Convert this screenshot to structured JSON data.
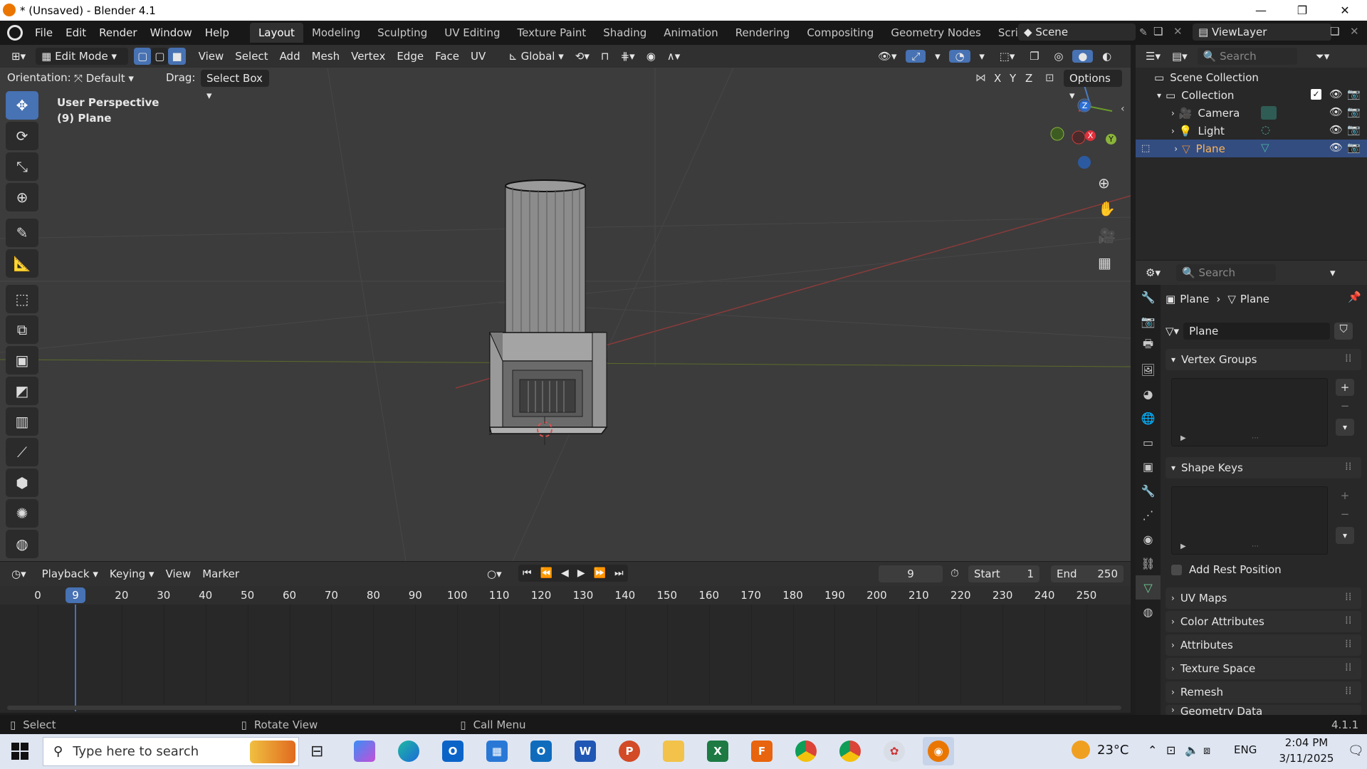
{
  "window": {
    "title": "* (Unsaved) - Blender 4.1",
    "minimize": "—",
    "maximize": "❐",
    "close": "✕"
  },
  "menu": [
    "File",
    "Edit",
    "Render",
    "Window",
    "Help"
  ],
  "workspaces": [
    "Layout",
    "Modeling",
    "Sculpting",
    "UV Editing",
    "Texture Paint",
    "Shading",
    "Animation",
    "Rendering",
    "Compositing",
    "Geometry Nodes",
    "Scripting"
  ],
  "active_workspace": "Layout",
  "scene": {
    "name": "Scene",
    "view_layer": "ViewLayer"
  },
  "viewport_header": {
    "mode": "Edit Mode",
    "menus": [
      "View",
      "Select",
      "Add",
      "Mesh",
      "Vertex",
      "Edge",
      "Face",
      "UV"
    ],
    "transform_orientation": "Global",
    "orientation_label": "Orientation:",
    "orientation_value": "Default",
    "drag_label": "Drag:",
    "drag_value": "Select Box",
    "axes": [
      "X",
      "Y",
      "Z"
    ],
    "options": "Options"
  },
  "viewport": {
    "perspective": "User Perspective",
    "object": "(9) Plane"
  },
  "gizmo": {
    "z": "Z",
    "x": "X",
    "y": "Y"
  },
  "outliner": {
    "search_placeholder": "Search",
    "scene_collection": "Scene Collection",
    "collection": "Collection",
    "items": [
      {
        "name": "Camera",
        "icon": "camera-icon"
      },
      {
        "name": "Light",
        "icon": "light-icon"
      },
      {
        "name": "Plane",
        "icon": "mesh-icon",
        "selected": true
      }
    ]
  },
  "properties": {
    "search_placeholder": "Search",
    "breadcrumb_object": "Plane",
    "breadcrumb_data": "Plane",
    "mesh_name": "Plane",
    "panels_open": [
      "Vertex Groups",
      "Shape Keys"
    ],
    "add_rest_position": "Add Rest Position",
    "panels_closed": [
      "UV Maps",
      "Color Attributes",
      "Attributes",
      "Texture Space",
      "Remesh",
      "Geometry Data"
    ]
  },
  "timeline": {
    "menus": [
      "Playback",
      "Keying",
      "View",
      "Marker"
    ],
    "current_frame": "9",
    "start_label": "Start",
    "start": "1",
    "end_label": "End",
    "end": "250",
    "ruler": [
      "0",
      "9",
      "20",
      "30",
      "40",
      "50",
      "60",
      "70",
      "80",
      "90",
      "100",
      "110",
      "120",
      "130",
      "140",
      "150",
      "160",
      "170",
      "180",
      "190",
      "200",
      "210",
      "220",
      "230",
      "240",
      "250"
    ]
  },
  "statusbar": {
    "select": "Select",
    "rotate": "Rotate View",
    "call_menu": "Call Menu",
    "version": "4.1.1"
  },
  "taskbar": {
    "search_placeholder": "Type here to search",
    "weather": "23°C",
    "language": "ENG",
    "time": "2:04 PM",
    "date": "3/11/2025"
  }
}
